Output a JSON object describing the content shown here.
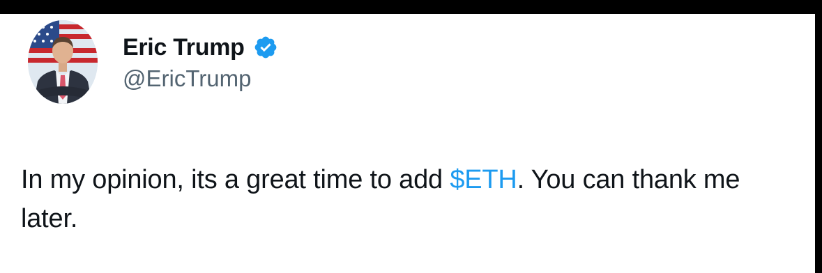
{
  "tweet": {
    "author": {
      "display_name": "Eric Trump",
      "handle": "@EricTrump",
      "verified": true,
      "avatar_icon": "profile-photo"
    },
    "text": {
      "before_cashtag": "In my opinion, its a great time to add ",
      "cashtag": "$ETH",
      "after_cashtag": ". You can thank me later."
    }
  },
  "colors": {
    "text": "#0f1419",
    "handle": "#536471",
    "link": "#1d9bf0",
    "verified_badge": "#1d9bf0",
    "frame": "#000000"
  }
}
